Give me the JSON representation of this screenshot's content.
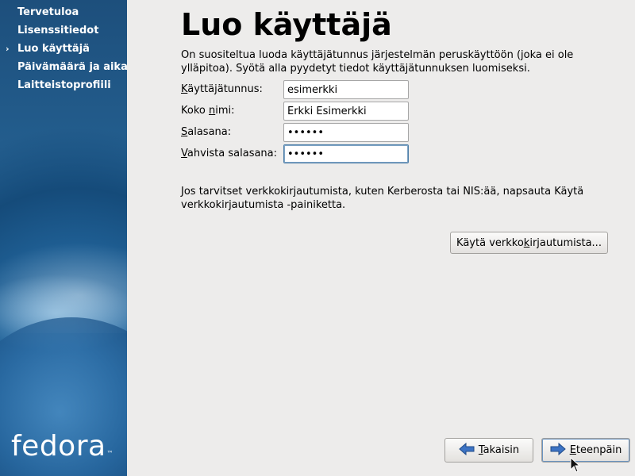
{
  "sidebar": {
    "items": [
      {
        "label": "Tervetuloa",
        "current": false
      },
      {
        "label": "Lisenssitiedot",
        "current": false
      },
      {
        "label": "Luo käyttäjä",
        "current": true
      },
      {
        "label": "Päivämäärä ja aika",
        "current": false
      },
      {
        "label": "Laitteistoprofiili",
        "current": false
      }
    ],
    "current_marker": "›",
    "logo_text": "fedora",
    "logo_mark": "™"
  },
  "main": {
    "title": "Luo käyttäjä",
    "intro": "On suositeltua luoda käyttäjätunnus järjestelmän peruskäyttöön (joka ei ole ylläpitoa). Syötä alla pyydetyt tiedot käyttäjätunnuksen luomiseksi.",
    "form": {
      "username": {
        "mnemonic": "K",
        "label_rest": "äyttäjätunnus:",
        "value": "esimerkki"
      },
      "fullname": {
        "label_pre": "Koko ",
        "mnemonic": "n",
        "label_rest": "imi:",
        "value": "Erkki Esimerkki"
      },
      "password": {
        "mnemonic": "S",
        "label_rest": "alasana:",
        "value": "••••••"
      },
      "confirm": {
        "mnemonic": "V",
        "label_rest": "ahvista salasana:",
        "value": "••••••"
      }
    },
    "network_note": "Jos tarvitset verkkokirjautumista, kuten Kerberosta tai NIS:ää, napsauta Käytä verkkokirjautumista -painiketta.",
    "network_button": {
      "pre": "Käytä verkko",
      "mnemonic": "k",
      "post": "irjautumista..."
    }
  },
  "footer": {
    "back": {
      "mnemonic": "T",
      "rest": "akaisin"
    },
    "forward": {
      "mnemonic": "E",
      "rest": "teenpäin"
    }
  },
  "colors": {
    "arrow_fill": "#3d74c4",
    "focus_border": "#4d7ea8"
  }
}
